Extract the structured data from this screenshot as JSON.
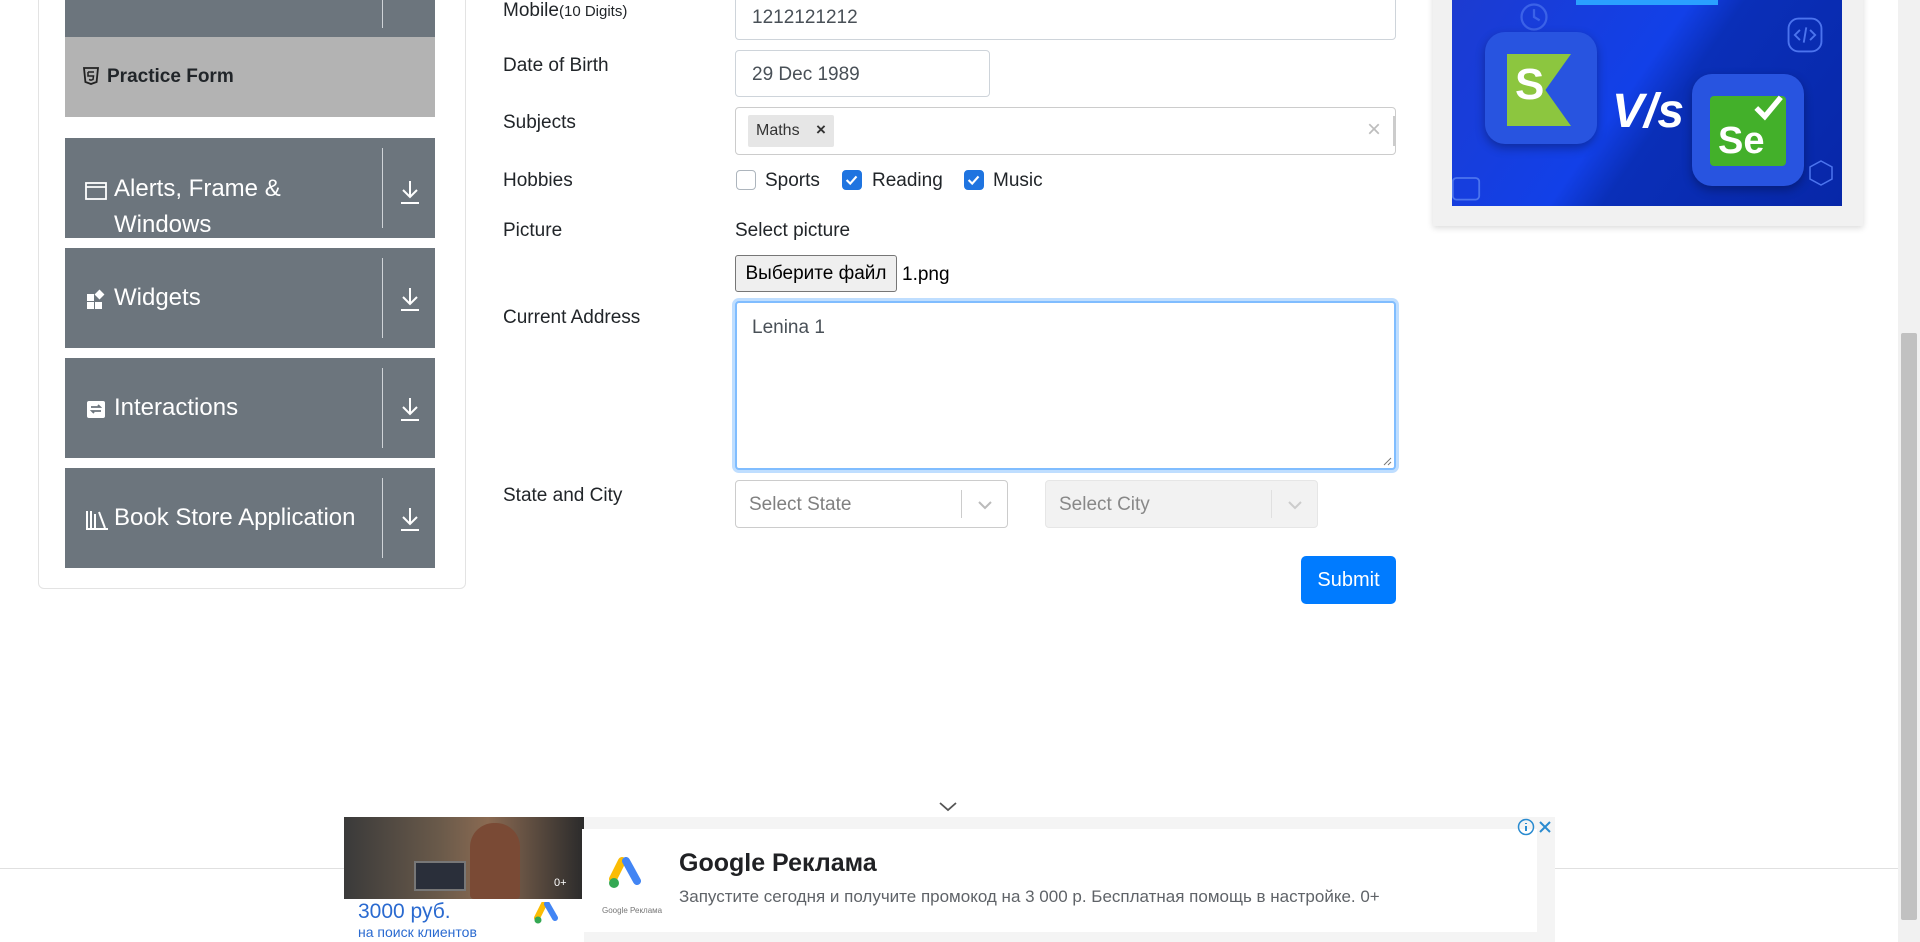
{
  "sidebar": {
    "practice_form": "Practice Form",
    "groups": [
      {
        "line1": "Alerts, Frame &",
        "line2": "Windows",
        "icon": "window-icon"
      },
      {
        "line1": "Widgets",
        "icon": "widgets-icon"
      },
      {
        "line1": "Interactions",
        "icon": "interactions-icon"
      },
      {
        "line1": "Book Store Application",
        "icon": "books-icon"
      }
    ]
  },
  "form": {
    "mobile_label": "Mobile",
    "mobile_hint": "(10 Digits)",
    "mobile_value": "1212121212",
    "dob_label": "Date of Birth",
    "dob_value": "29 Dec 1989",
    "subjects_label": "Subjects",
    "subject_chip": "Maths",
    "hobbies_label": "Hobbies",
    "hobbies": [
      {
        "label": "Sports",
        "checked": false
      },
      {
        "label": "Reading",
        "checked": true
      },
      {
        "label": "Music",
        "checked": true
      }
    ],
    "picture_label": "Picture",
    "select_picture": "Select picture",
    "file_button": "Выберите файл",
    "file_name": "1.png",
    "address_label": "Current Address",
    "address_value": "Lenina 1",
    "state_city_label": "State and City",
    "state_placeholder": "Select State",
    "city_placeholder": "Select City",
    "submit": "Submit"
  },
  "bottom_ad": {
    "title": "Google Реклама",
    "text": "Запустите сегодня и получите промокод на 3 000 р. Бесплатная помощь в настройке. 0+",
    "price": "3000 руб.",
    "price_sub": "на поиск клиентов",
    "logo_caption": "Google Реклама",
    "age": "0+"
  },
  "colors": {
    "sidebar_bg": "#6c757d",
    "active_item_bg": "#b3b3b3",
    "accent": "#007bff",
    "checkbox_on": "#1f74e0"
  }
}
